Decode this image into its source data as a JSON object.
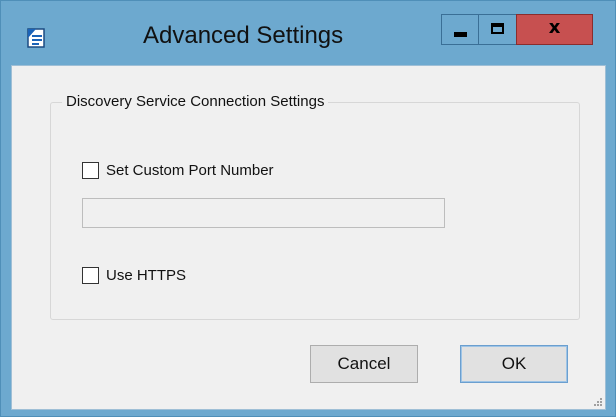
{
  "window": {
    "title": "Advanced Settings",
    "app_icon": "document-icon",
    "controls": {
      "minimize_icon": "minimize-icon",
      "maximize_icon": "maximize-icon",
      "close_glyph": "x"
    },
    "close_color": "#c75050",
    "frame_color": "#6da9cf"
  },
  "group": {
    "legend": "Discovery Service Connection Settings",
    "custom_port": {
      "label": "Set Custom Port Number",
      "checked": false
    },
    "port_input": {
      "value": "",
      "placeholder": ""
    },
    "use_https": {
      "label": "Use HTTPS",
      "checked": false
    }
  },
  "buttons": {
    "cancel_label": "Cancel",
    "ok_label": "OK"
  }
}
